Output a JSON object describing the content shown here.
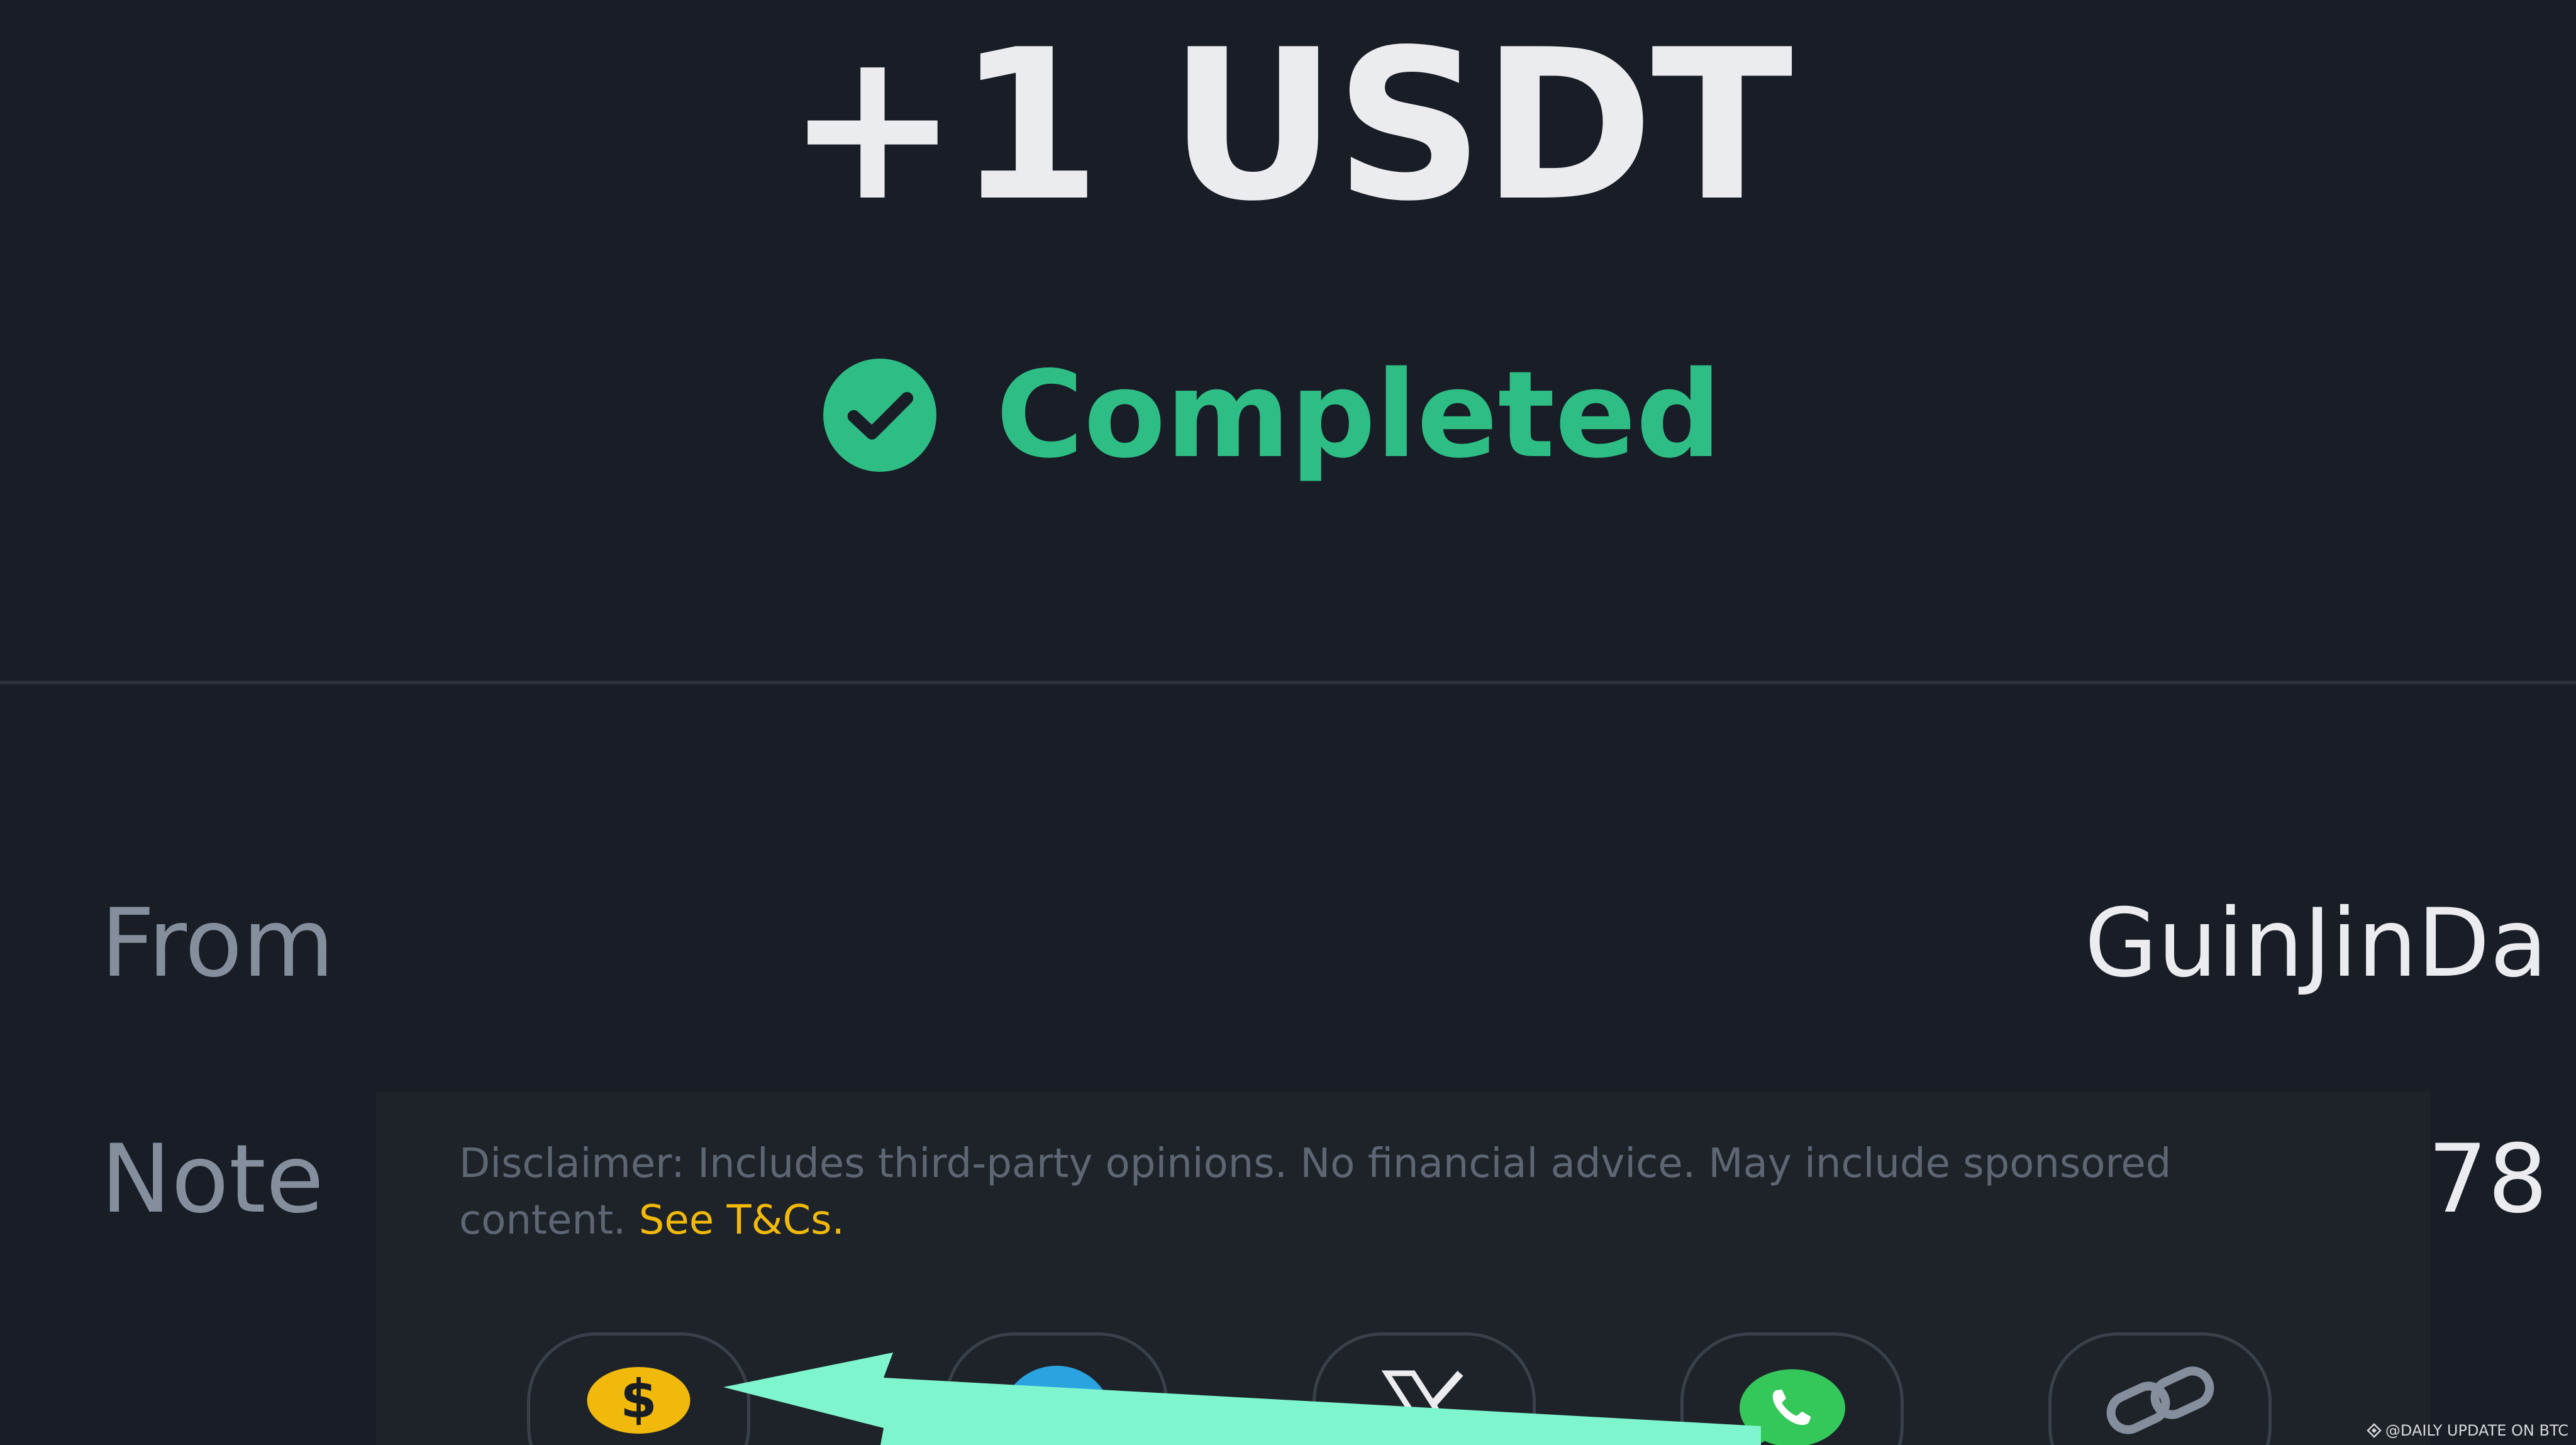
{
  "transaction": {
    "amount": "+1 USDT",
    "status": "Completed"
  },
  "details": {
    "from_label": "From",
    "from_value": "GuinJinDa",
    "note_label": "Note",
    "note_value_visible": "78"
  },
  "disclaimer": {
    "text": "Disclaimer: Includes third-party opinions. No financial advice. May include sponsored content. ",
    "link_label": "See T&Cs."
  },
  "share_buttons": [
    {
      "icon": "dollar-icon"
    },
    {
      "icon": "telegram-icon"
    },
    {
      "icon": "x-icon"
    },
    {
      "icon": "whatsapp-icon"
    },
    {
      "icon": "link-icon"
    }
  ],
  "watermark": {
    "text": "@DAILY UPDATE ON BTC"
  },
  "colors": {
    "background": "#181d26",
    "status_green": "#2ebd85",
    "link_yellow": "#f0b90b",
    "arrow": "#7ff5cf"
  }
}
